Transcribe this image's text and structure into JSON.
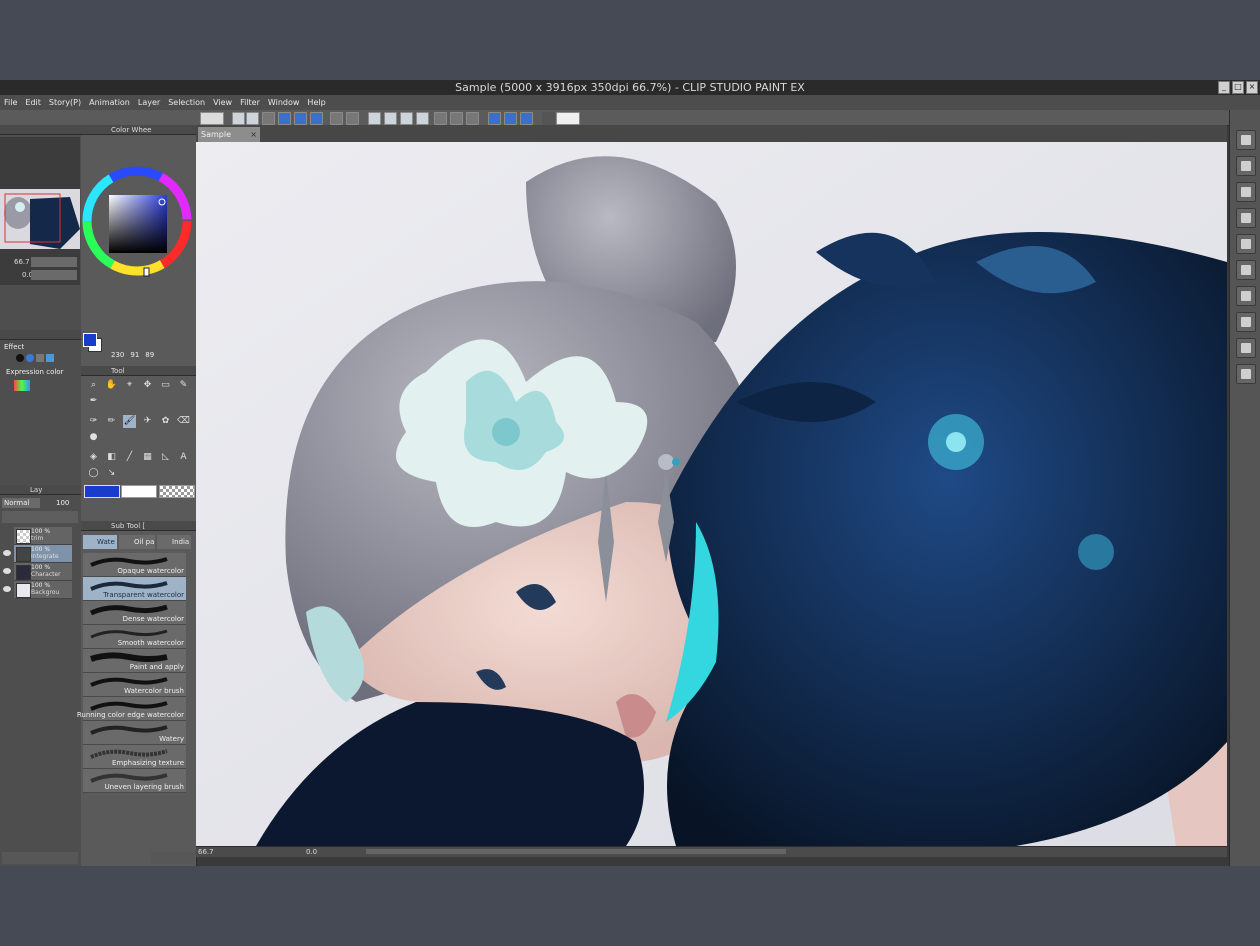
{
  "window": {
    "title": "Sample (5000 x 3916px 350dpi 66.7%)  - CLIP STUDIO PAINT EX"
  },
  "menu": [
    "File",
    "Edit",
    "Story(P)",
    "Animation",
    "Layer",
    "Selection",
    "View",
    "Filter",
    "Window",
    "Help"
  ],
  "document_tab": {
    "label": "Sample",
    "close": "×"
  },
  "navigator": {
    "zoom": "66.7",
    "rotation": "0.0"
  },
  "color_wheel": {
    "title": "Color Whee",
    "h": "230",
    "s": "91",
    "v": "89",
    "main_color": "#1a3ccc",
    "sub_color": "#ffffff"
  },
  "tool_property": {
    "effect_label": "Effect",
    "expression_label": "Expression color"
  },
  "tool_panel": {
    "title": "Tool"
  },
  "layers": {
    "tab_label": "Lay",
    "blend_mode": "Normal",
    "opacity": "100",
    "rows": [
      {
        "pct": "100 %",
        "name": "trim"
      },
      {
        "pct": "100 %",
        "name": "Integrate"
      },
      {
        "pct": "100 %",
        "name": "Character"
      },
      {
        "pct": "100 %",
        "name": "Backgrou"
      }
    ]
  },
  "sub_tool": {
    "title": "Sub Tool [",
    "tabs": [
      "Wate",
      "Oil pa",
      "India"
    ],
    "brushes": [
      "Opaque watercolor",
      "Transparent watercolor",
      "Dense watercolor",
      "Smooth watercolor",
      "Paint and apply",
      "Watercolor brush",
      "Running color edge watercolor",
      "Watery",
      "Emphasizing texture",
      "Uneven layering brush"
    ]
  },
  "status": {
    "zoom": "66.7",
    "rotation": "0.0"
  },
  "colors": {
    "accent": "#1a3ccc",
    "selection": "#9fb3c8",
    "hair": "#9a9aa6",
    "feather": "#10264a",
    "turquoise": "#34d6e0"
  }
}
